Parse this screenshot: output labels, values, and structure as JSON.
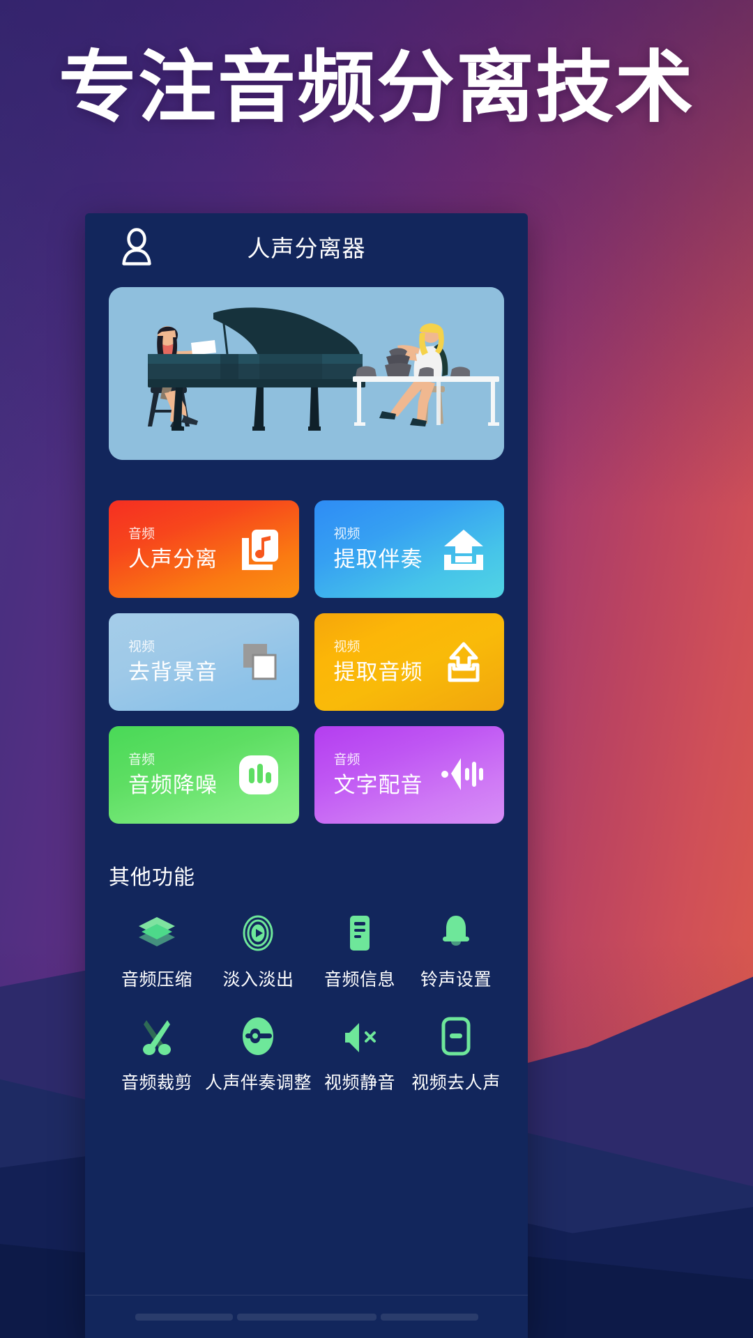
{
  "poster": {
    "headline": "专注音频分离技术",
    "background": {
      "sky_left_color": "#43327e",
      "sky_right_color": "#dd5e4a",
      "mountain_colors": [
        "#2d2a6b",
        "#1e2a63",
        "#132055",
        "#0d1a48"
      ]
    }
  },
  "app": {
    "screen_bg": "#12265c",
    "appbar": {
      "title": "人声分离器",
      "avatar_icon": "user-avatar-icon"
    },
    "hero": {
      "alt": "插画：弹钢琴的女士与制陶的女士",
      "bg_color": "#8fbfdd"
    },
    "feature_cards": [
      {
        "sub": "音频",
        "title": "人声分离",
        "icon": "music-note-card-icon",
        "color_start": "#f52f22",
        "color_end": "#fb9211",
        "theme": "c-red"
      },
      {
        "sub": "视频",
        "title": "提取伴奏",
        "icon": "upload-solid-icon",
        "color_start": "#2e8cf5",
        "color_end": "#51d4e4",
        "theme": "c-blue"
      },
      {
        "sub": "视频",
        "title": "去背景音",
        "icon": "copy-layers-icon",
        "color_start": "#a5cde9",
        "color_end": "#87c0e8",
        "theme": "c-ltblue"
      },
      {
        "sub": "视频",
        "title": "提取音频",
        "icon": "upload-outline-icon",
        "color_start": "#f5a60b",
        "color_end": "#f1a60d",
        "theme": "c-orange"
      },
      {
        "sub": "音频",
        "title": "音频降噪",
        "icon": "bar-chart-icon",
        "color_start": "#49d957",
        "color_end": "#8cef89",
        "theme": "c-green"
      },
      {
        "sub": "音频",
        "title": "文字配音",
        "icon": "speaker-wave-icon",
        "color_start": "#b43ef0",
        "color_end": "#d78ef6",
        "theme": "c-purple"
      }
    ],
    "others": {
      "section_title": "其他功能",
      "accent_color": "#6ee79a",
      "items": [
        {
          "label": "音频压缩",
          "icon": "layers-icon"
        },
        {
          "label": "淡入淡出",
          "icon": "disc-play-icon"
        },
        {
          "label": "音频信息",
          "icon": "document-info-icon"
        },
        {
          "label": "铃声设置",
          "icon": "bell-icon"
        },
        {
          "label": "音频裁剪",
          "icon": "scissors-icon"
        },
        {
          "label": "人声伴奏调整",
          "icon": "slider-knob-icon"
        },
        {
          "label": "视频静音",
          "icon": "speaker-mute-icon"
        },
        {
          "label": "视频去人声",
          "icon": "phone-minus-icon"
        }
      ]
    }
  }
}
